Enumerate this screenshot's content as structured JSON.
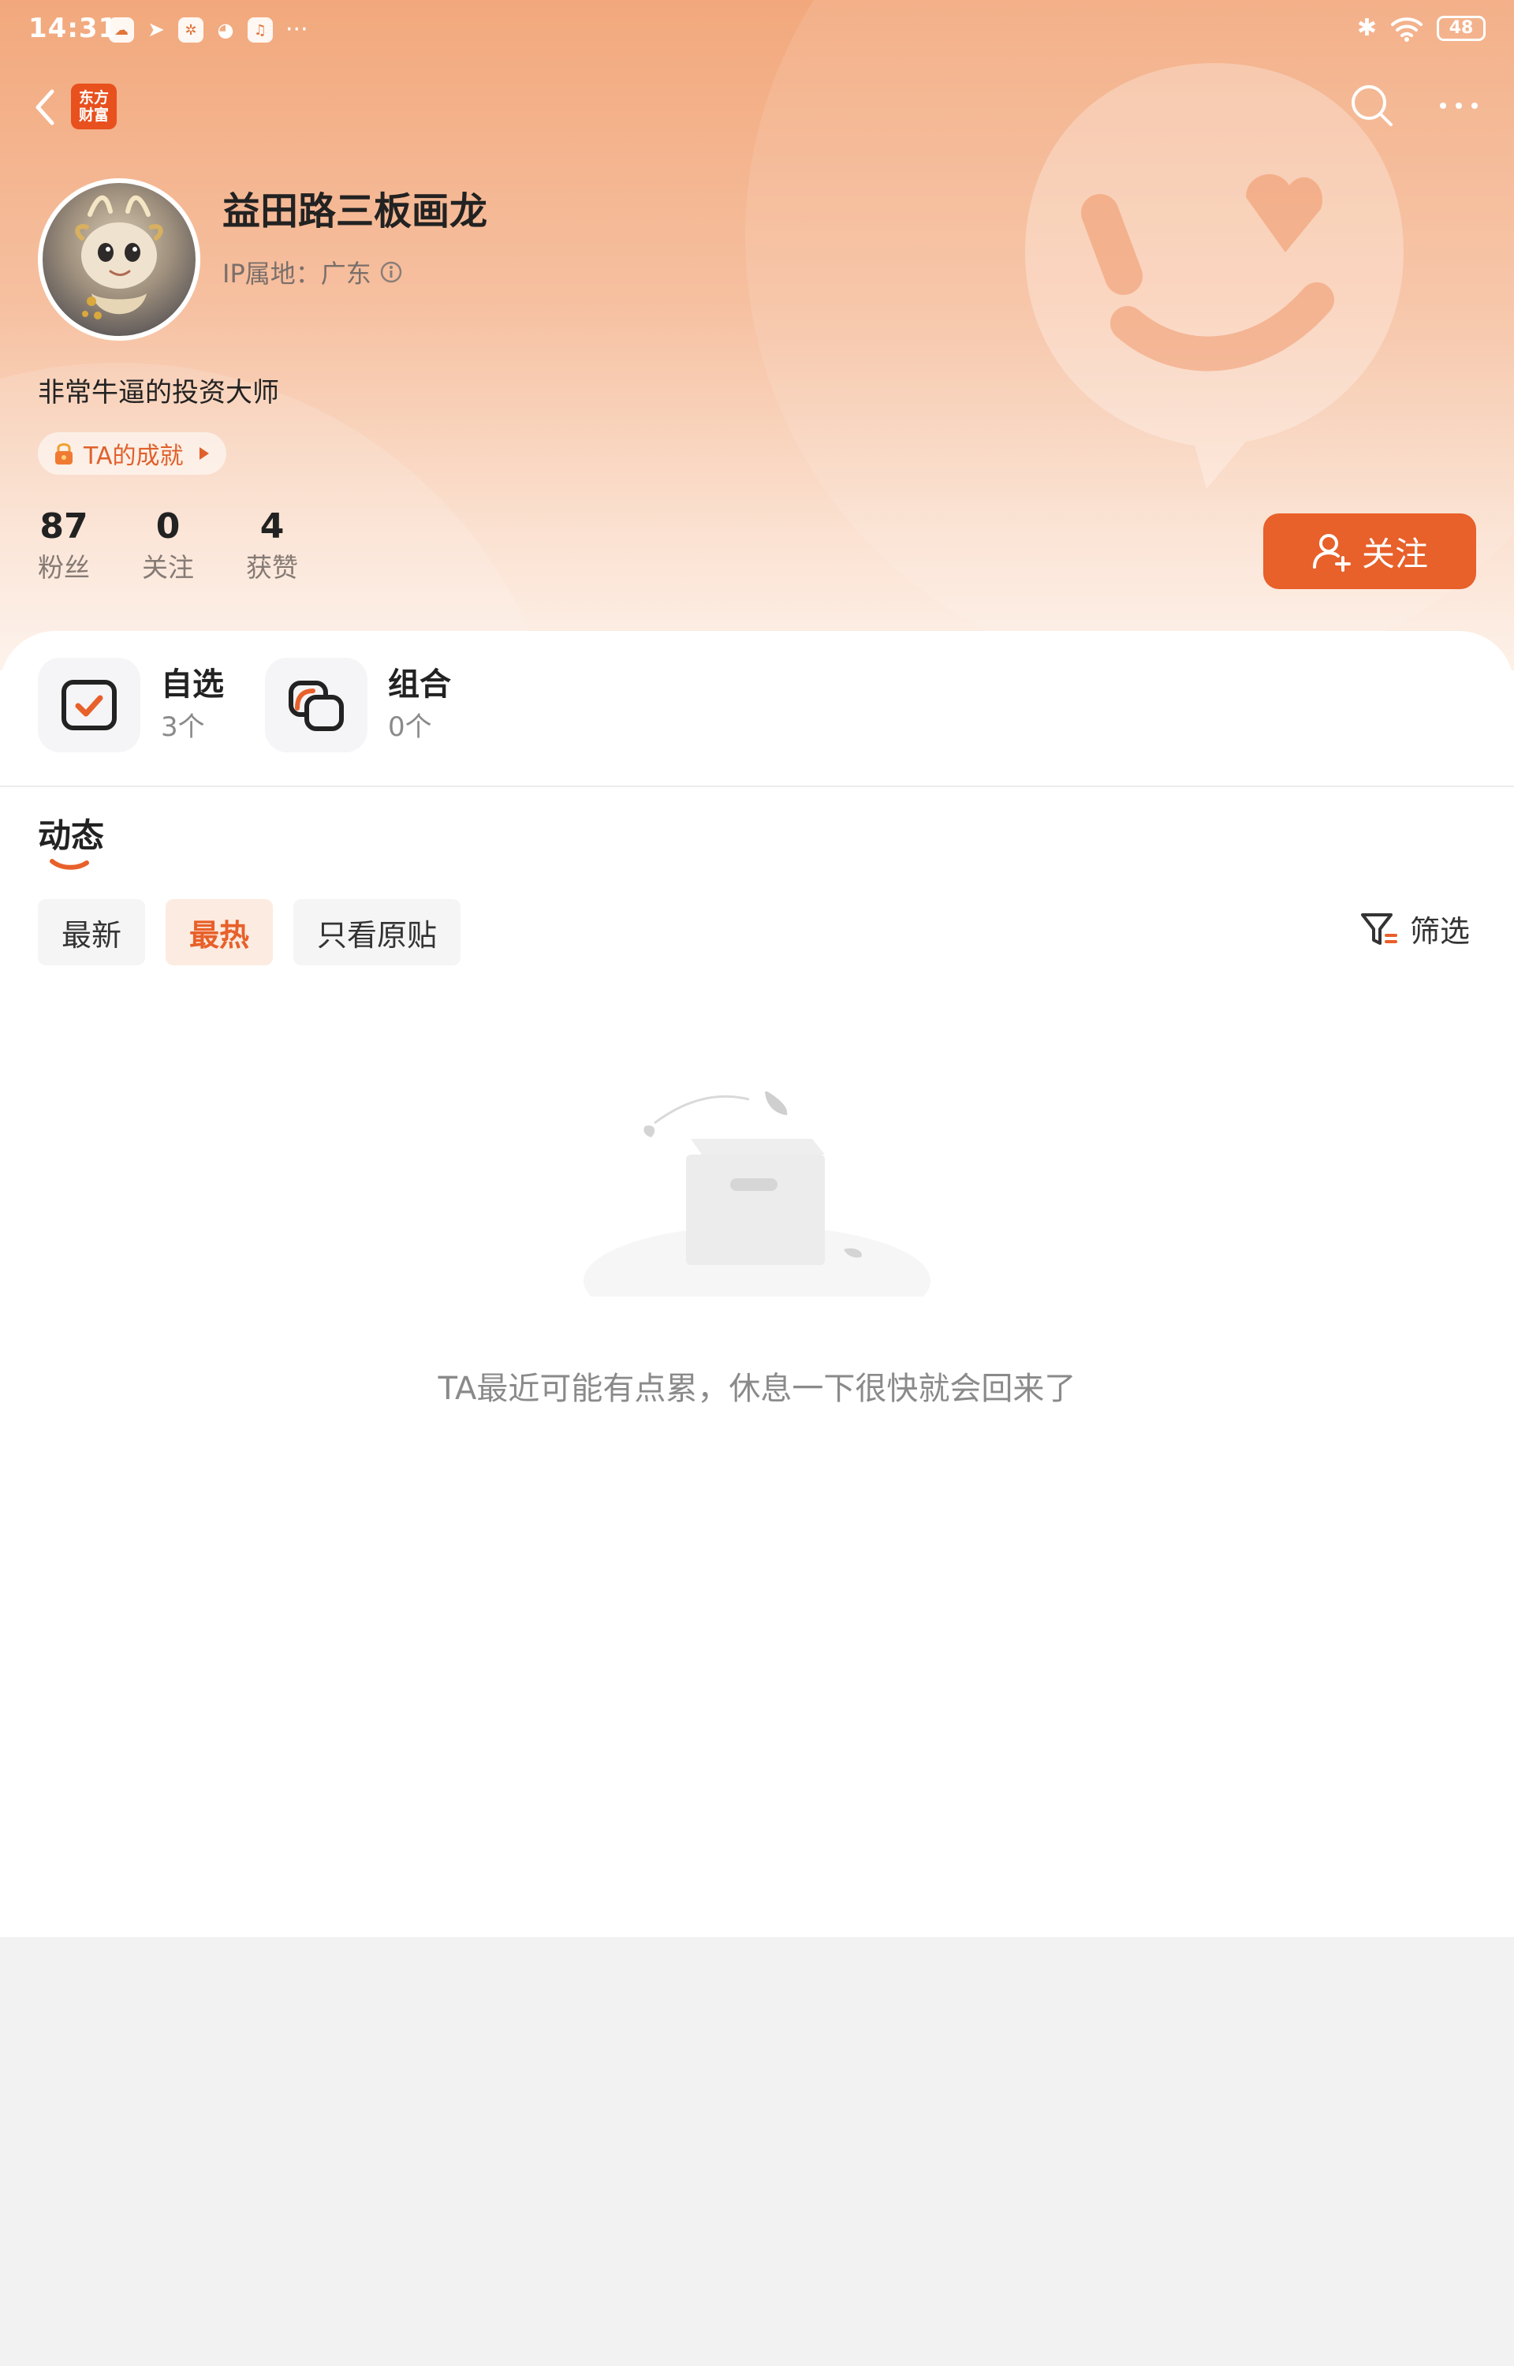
{
  "status_bar": {
    "time": "14:31",
    "more": "···",
    "battery": "48"
  },
  "nav": {
    "brand_logo": "东方\n财富"
  },
  "profile": {
    "username": "益田路三板画龙",
    "ip_location": "IP属地：广东",
    "bio": "非常牛逼的投资大师",
    "achievement_label": "TA的成就",
    "stats": [
      {
        "value": "87",
        "label": "粉丝"
      },
      {
        "value": "0",
        "label": "关注"
      },
      {
        "value": "4",
        "label": "获赞"
      }
    ],
    "follow_button": "关注"
  },
  "shortcuts": [
    {
      "title": "自选",
      "count": "3个"
    },
    {
      "title": "组合",
      "count": "0个"
    }
  ],
  "feed": {
    "section_title": "动态",
    "tabs": [
      {
        "label": "最新",
        "active": false
      },
      {
        "label": "最热",
        "active": true
      },
      {
        "label": "只看原贴",
        "active": false
      }
    ],
    "filter_label": "筛选",
    "empty_message": "TA最近可能有点累，休息一下很快就会回来了"
  },
  "colors": {
    "accent": "#e8602a",
    "brand": "#e8501e",
    "hero_top": "#f2a87c"
  }
}
